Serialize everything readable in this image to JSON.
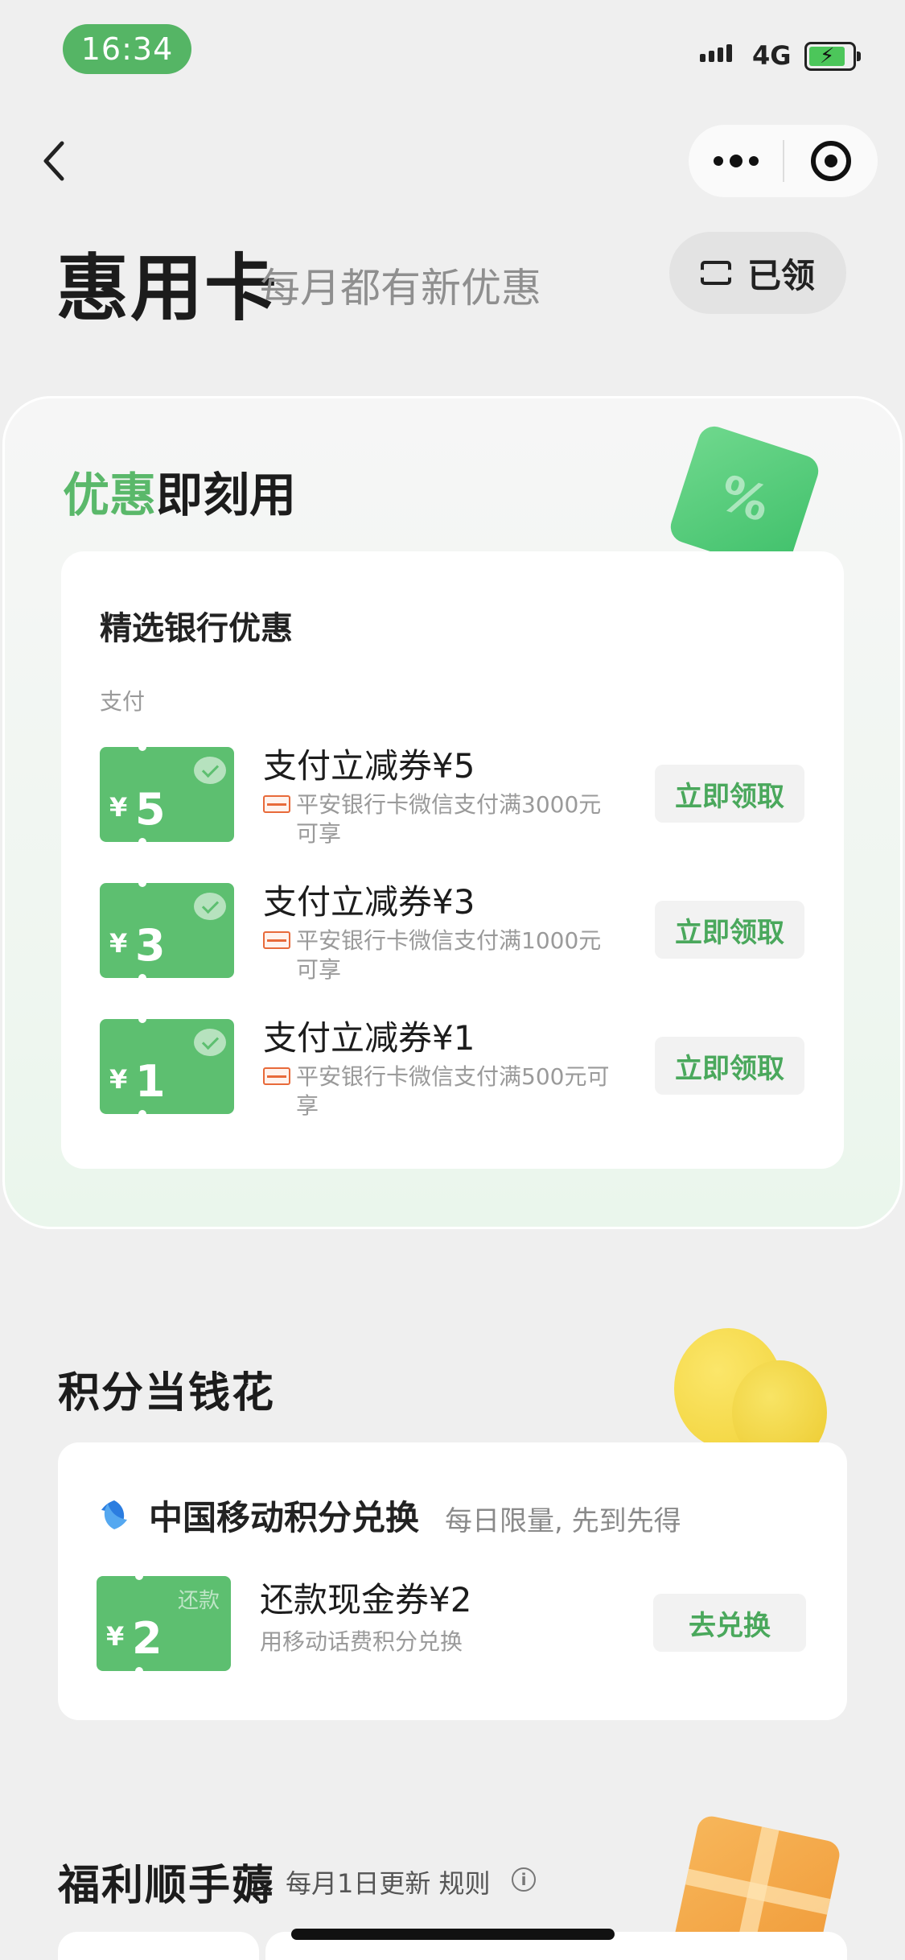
{
  "status_bar": {
    "time": "16:34",
    "network": "4G"
  },
  "header": {
    "title": "惠用卡",
    "subtitle": "每月都有新优惠",
    "claimed_label": "已领"
  },
  "section_instant": {
    "title_green": "优惠",
    "title_rest": "即刻用",
    "card_title": "精选银行优惠",
    "category_label": "支付",
    "coupons": [
      {
        "currency": "¥",
        "amount": "5",
        "name": "支付立减券¥5",
        "desc": "平安银行卡微信支付满3000元可享",
        "action": "立即领取"
      },
      {
        "currency": "¥",
        "amount": "3",
        "name": "支付立减券¥3",
        "desc": "平安银行卡微信支付满1000元可享",
        "action": "立即领取"
      },
      {
        "currency": "¥",
        "amount": "1",
        "name": "支付立减券¥1",
        "desc": "平安银行卡微信支付满500元可享",
        "action": "立即领取"
      }
    ]
  },
  "section_points": {
    "title": "积分当钱花",
    "provider_title": "中国移动积分兑换",
    "provider_sub": "每日限量, 先到先得",
    "coupon": {
      "currency": "¥",
      "amount": "2",
      "tag": "还款",
      "name": "还款现金券¥2",
      "desc": "用移动话费积分兑换",
      "action": "去兑换"
    }
  },
  "section_welfare": {
    "title": "福利顺手薅",
    "sub": "每月1日更新 规则",
    "info_glyph": "i"
  },
  "colors": {
    "accent": "#5ab86a",
    "tile": "#5dbf70",
    "button_text": "#4aa85c"
  }
}
